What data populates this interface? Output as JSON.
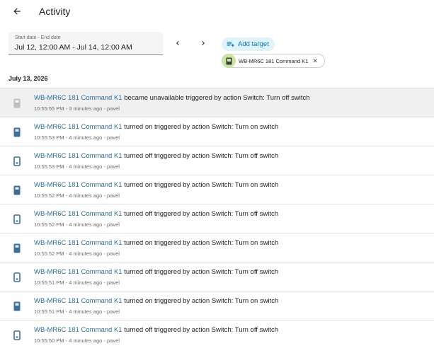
{
  "header": {
    "title": "Activity"
  },
  "date_range": {
    "label": "Start date - End date",
    "value": "Jul 12, 12:00 AM - Jul 14, 12:00 AM"
  },
  "add_target": {
    "label": "Add target"
  },
  "target_chip": {
    "label": "WB-MR6C 181 Command K1",
    "close": "✕"
  },
  "day_header": "July 13, 2026",
  "entries": [
    {
      "entity": "WB-MR6C 181 Command K1",
      "message": "became unavailable triggered by action Switch: Turn off switch",
      "meta": "10:55:55 PM - 3 minutes ago - pavel",
      "icon": "unavailable-switch-icon",
      "icon_color": "#bdbdbd"
    },
    {
      "entity": "WB-MR6C 181 Command K1",
      "message": "turned on triggered by action Switch: Turn on switch",
      "meta": "10:55:53 PM - 4 minutes ago - pavel",
      "icon": "switch-on-icon",
      "icon_color": "#3a6f9c"
    },
    {
      "entity": "WB-MR6C 181 Command K1",
      "message": "turned off triggered by action Switch: Turn off switch",
      "meta": "10:55:53 PM - 4 minutes ago - pavel",
      "icon": "switch-off-icon",
      "icon_color": "#3a6f9c"
    },
    {
      "entity": "WB-MR6C 181 Command K1",
      "message": "turned on triggered by action Switch: Turn on switch",
      "meta": "10:55:52 PM - 4 minutes ago - pavel",
      "icon": "switch-on-icon",
      "icon_color": "#3a6f9c"
    },
    {
      "entity": "WB-MR6C 181 Command K1",
      "message": "turned off triggered by action Switch: Turn off switch",
      "meta": "10:55:52 PM - 4 minutes ago - pavel",
      "icon": "switch-off-icon",
      "icon_color": "#3a6f9c"
    },
    {
      "entity": "WB-MR6C 181 Command K1",
      "message": "turned on triggered by action Switch: Turn on switch",
      "meta": "10:55:52 PM - 4 minutes ago - pavel",
      "icon": "switch-on-icon",
      "icon_color": "#3a6f9c"
    },
    {
      "entity": "WB-MR6C 181 Command K1",
      "message": "turned off triggered by action Switch: Turn off switch",
      "meta": "10:55:51 PM - 4 minutes ago - pavel",
      "icon": "switch-off-icon",
      "icon_color": "#3a6f9c"
    },
    {
      "entity": "WB-MR6C 181 Command K1",
      "message": "turned on triggered by action Switch: Turn on switch",
      "meta": "10:55:51 PM - 4 minutes ago - pavel",
      "icon": "switch-on-icon",
      "icon_color": "#3a6f9c"
    },
    {
      "entity": "WB-MR6C 181 Command K1",
      "message": "turned off triggered by action Switch: Turn off switch",
      "meta": "10:55:50 PM - 4 minutes ago - pavel",
      "icon": "switch-off-icon",
      "icon_color": "#3a6f9c"
    }
  ],
  "colors": {
    "accent": "#0277bd",
    "link": "#2c6e9e",
    "chip_avatar": "#c8e6a0",
    "highlight_row": "#f0f0f0"
  }
}
